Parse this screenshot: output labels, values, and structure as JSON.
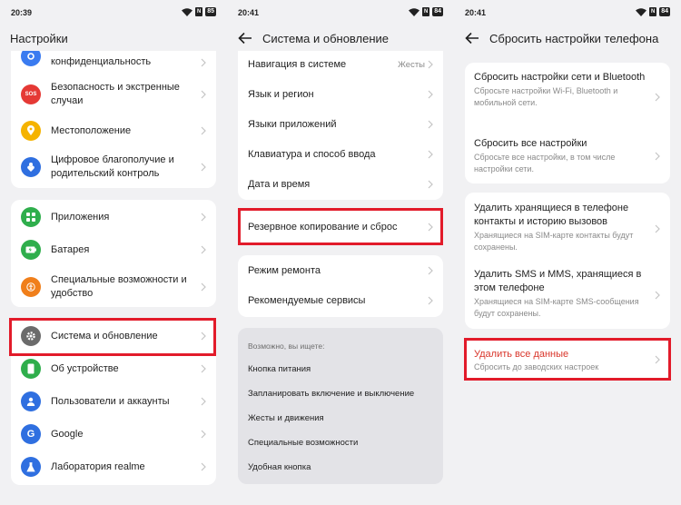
{
  "screen1": {
    "time": "20:39",
    "battery": "85",
    "title": "Настройки",
    "group1": [
      {
        "label": "конфиденциальность",
        "icon": "privacy-icon",
        "color": "#3a7bf0"
      },
      {
        "label": "Безопасность и экстренные случаи",
        "icon": "sos-icon",
        "color": "#e53935",
        "icon_text": "SOS"
      },
      {
        "label": "Местоположение",
        "icon": "location-icon",
        "color": "#f5b300"
      },
      {
        "label": "Цифровое благополучие и родительский контроль",
        "icon": "wellbeing-icon",
        "color": "#2f6fe0"
      }
    ],
    "group2": [
      {
        "label": "Приложения",
        "icon": "apps-icon",
        "color": "#2fae4c"
      },
      {
        "label": "Батарея",
        "icon": "battery-icon",
        "color": "#2fae4c"
      },
      {
        "label": "Специальные возможности и удобство",
        "icon": "accessibility-icon",
        "color": "#f07f1b"
      }
    ],
    "group3": [
      {
        "label": "Система и обновление",
        "icon": "gear-icon",
        "color": "#6b6b6b"
      },
      {
        "label": "Об устройстве",
        "icon": "phone-icon",
        "color": "#2fae4c"
      },
      {
        "label": "Пользователи и аккаунты",
        "icon": "users-icon",
        "color": "#2f6fe0"
      },
      {
        "label": "Google",
        "icon": "google-icon",
        "color": "#2f6fe0",
        "icon_text": "G"
      },
      {
        "label": "Лаборатория realme",
        "icon": "lab-icon",
        "color": "#2f6fe0"
      }
    ]
  },
  "screen2": {
    "time": "20:41",
    "battery": "84",
    "title": "Система и обновление",
    "group1": [
      {
        "label": "Навигация в системе",
        "value": "Жесты"
      },
      {
        "label": "Язык и регион"
      },
      {
        "label": "Языки приложений"
      },
      {
        "label": "Клавиатура и способ ввода"
      },
      {
        "label": "Дата и время"
      }
    ],
    "backup": {
      "label": "Резервное копирование и сброс"
    },
    "group3": [
      {
        "label": "Режим ремонта"
      },
      {
        "label": "Рекомендуемые сервисы"
      }
    ],
    "suggest_title": "Возможно, вы ищете:",
    "suggest": [
      "Кнопка питания",
      "Запланировать включение и выключение",
      "Жесты и движения",
      "Специальные возможности",
      "Удобная кнопка"
    ]
  },
  "screen3": {
    "time": "20:41",
    "battery": "84",
    "title": "Сбросить настройки телефона",
    "group1": [
      {
        "title": "Сбросить настройки сети и Bluetooth",
        "sub": "Сбросьте настройки Wi-Fi, Bluetooth и мобильной сети."
      },
      {
        "title": "Сбросить все настройки",
        "sub": "Сбросьте все настройки, в том числе настройки сети."
      }
    ],
    "group2": [
      {
        "title": "Удалить хранящиеся в телефоне контакты и историю вызовов",
        "sub": "Хранящиеся на SIM-карте контакты будут сохранены."
      },
      {
        "title": "Удалить SMS и MMS, хранящиеся в этом телефоне",
        "sub": "Хранящиеся на SIM-карте SMS-сообщения будут сохранены."
      }
    ],
    "erase": {
      "title": "Удалить все данные",
      "sub": "Сбросить до заводских настроек"
    }
  },
  "colors": {
    "highlight": "#e21b2a",
    "danger": "#d9362b",
    "background": "#f1f1f3"
  }
}
